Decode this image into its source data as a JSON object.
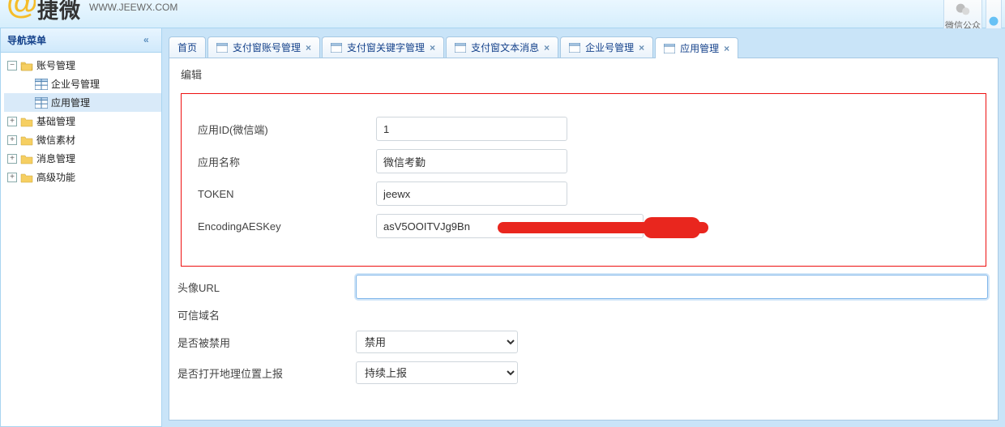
{
  "header": {
    "brand": "捷微",
    "site_url": "WWW.JEEWX.COM",
    "btn_wechat_label": "微信公众"
  },
  "sidebar": {
    "title": "导航菜单",
    "nodes": {
      "account_mgmt": "账号管理",
      "enterprise_mgmt": "企业号管理",
      "app_mgmt": "应用管理",
      "basic_mgmt": "基础管理",
      "wechat_material": "微信素材",
      "message_mgmt": "消息管理",
      "advanced": "高级功能"
    }
  },
  "tabs": {
    "home": "首页",
    "pay_account": "支付窗账号管理",
    "pay_keyword": "支付窗关键字管理",
    "pay_text": "支付窗文本消息",
    "enterprise": "企业号管理",
    "app": "应用管理"
  },
  "form": {
    "section_title": "编辑",
    "app_id_label": "应用ID(微信端)",
    "app_id_value": "1",
    "app_name_label": "应用名称",
    "app_name_value": "微信考勤",
    "token_label": "TOKEN",
    "token_value": "jeewx",
    "aeskey_label": "EncodingAESKey",
    "aeskey_value": "asV5OOITVJg9Bn",
    "avatar_label": "头像URL",
    "avatar_value": "",
    "trust_domain_label": "可信域名",
    "disabled_label": "是否被禁用",
    "disabled_value": "禁用",
    "geo_report_label": "是否打开地理位置上报",
    "geo_report_value": "持续上报"
  }
}
